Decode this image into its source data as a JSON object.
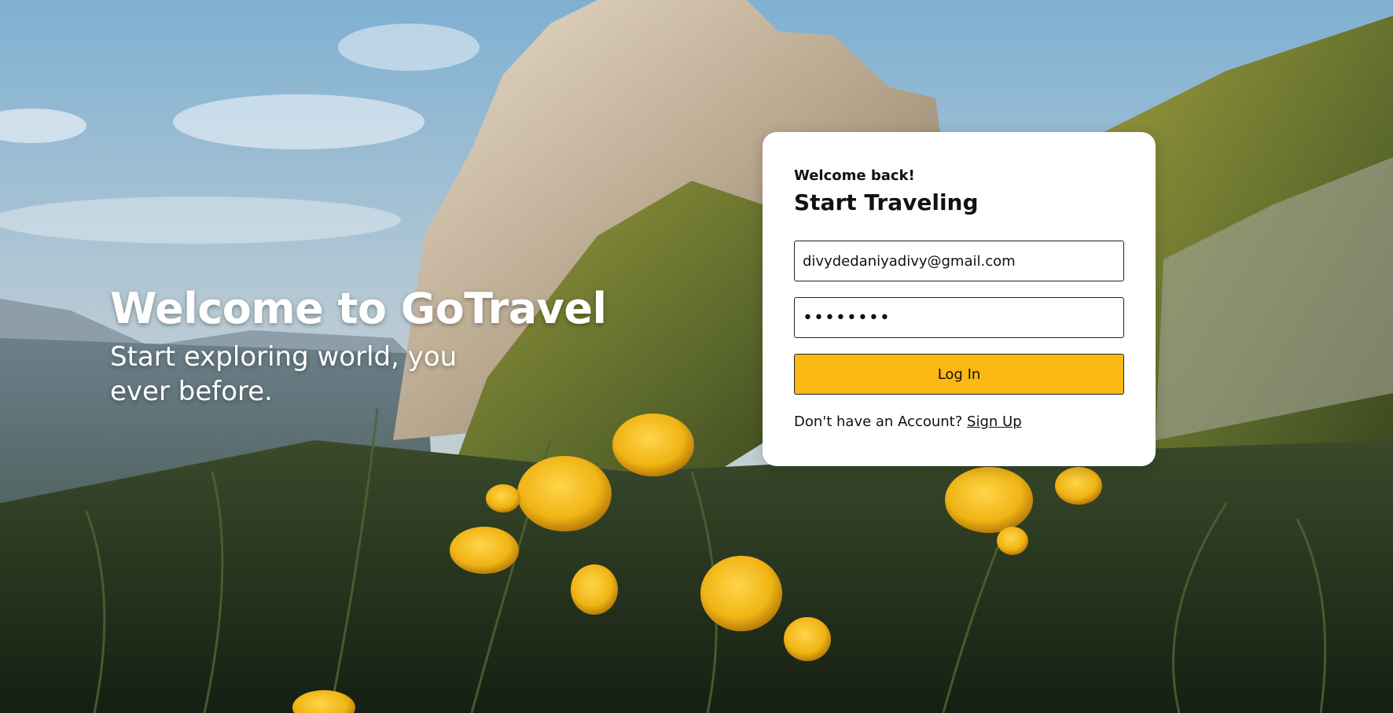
{
  "hero": {
    "title": "Welcome to GoTravel",
    "subtitle": "Start exploring world, you ever before."
  },
  "login_card": {
    "welcome": "Welcome back!",
    "title": "Start Traveling",
    "email_value": "divydedaniyadivy@gmail.com",
    "password_value": "••••••••",
    "login_label": "Log In",
    "signup_prompt": "Don't have an Account?",
    "signup_label": "Sign Up"
  },
  "colors": {
    "button": "#fdb913",
    "card": "#ffffff",
    "text": "#111111"
  },
  "icons": {
    "background": "mountain-landscape-photo"
  }
}
